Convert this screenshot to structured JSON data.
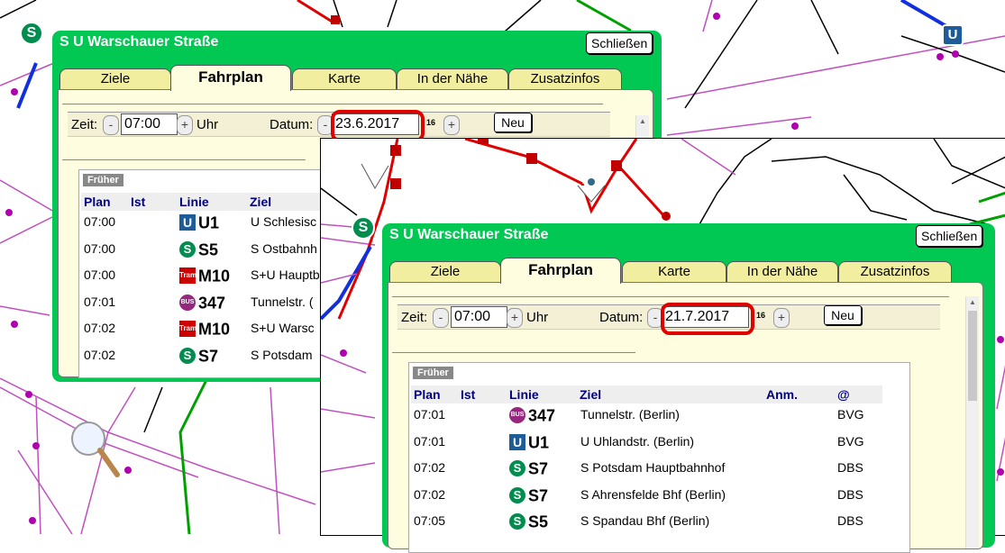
{
  "colors": {
    "panel_green": "#00c853",
    "tab_yellow": "#f2eea0",
    "highlight_red": "#e00000",
    "header_blue": "#000080"
  },
  "icons": [
    "magnifier-icon",
    "s-bahn-icon",
    "u-bahn-icon",
    "tram-icon",
    "bus-icon",
    "calendar-icon"
  ],
  "map_icons": {
    "s": "S",
    "u": "U"
  },
  "panel_a": {
    "title": "S U Warschauer Straße",
    "close_label": "Schließen",
    "tabs": [
      "Ziele",
      "Fahrplan",
      "Karte",
      "In der Nähe",
      "Zusatzinfos"
    ],
    "active_tab": "Fahrplan",
    "controls": {
      "zeit_label": "Zeit:",
      "minus": "-",
      "plus": "+",
      "time": "07:00",
      "uhr_label": "Uhr",
      "datum_label": "Datum:",
      "date": "23.6.2017",
      "calendar": "16",
      "neu_label": "Neu"
    },
    "earlier_label": "Früher",
    "headers": [
      "Plan",
      "Ist",
      "Linie",
      "Ziel"
    ],
    "rows": [
      {
        "plan": "07:00",
        "icon": "U",
        "line": "U1",
        "ziel": "U Schlesisc"
      },
      {
        "plan": "07:00",
        "icon": "S",
        "line": "S5",
        "ziel": "S Ostbahnh"
      },
      {
        "plan": "07:00",
        "icon": "Tram",
        "line": "M10",
        "ziel": "S+U Hauptb"
      },
      {
        "plan": "07:01",
        "icon": "BUS",
        "line": "347",
        "ziel": "Tunnelstr. ("
      },
      {
        "plan": "07:02",
        "icon": "Tram",
        "line": "M10",
        "ziel": "S+U Warsc"
      },
      {
        "plan": "07:02",
        "icon": "S",
        "line": "S7",
        "ziel": "S Potsdam"
      }
    ]
  },
  "panel_b": {
    "title": "S U Warschauer Straße",
    "close_label": "Schließen",
    "tabs": [
      "Ziele",
      "Fahrplan",
      "Karte",
      "In der Nähe",
      "Zusatzinfos"
    ],
    "active_tab": "Fahrplan",
    "controls": {
      "zeit_label": "Zeit:",
      "minus": "-",
      "plus": "+",
      "time": "07:00",
      "uhr_label": "Uhr",
      "datum_label": "Datum:",
      "date": "21.7.2017",
      "calendar": "16",
      "neu_label": "Neu"
    },
    "earlier_label": "Früher",
    "headers": [
      "Plan",
      "Ist",
      "Linie",
      "Ziel",
      "Anm.",
      "@"
    ],
    "rows": [
      {
        "plan": "07:01",
        "icon": "BUS",
        "line": "347",
        "ziel": "Tunnelstr. (Berlin)",
        "op": "BVG"
      },
      {
        "plan": "07:01",
        "icon": "U",
        "line": "U1",
        "ziel": "U Uhlandstr. (Berlin)",
        "op": "BVG"
      },
      {
        "plan": "07:02",
        "icon": "S",
        "line": "S7",
        "ziel": "S Potsdam Hauptbahnhof",
        "op": "DBS"
      },
      {
        "plan": "07:02",
        "icon": "S",
        "line": "S7",
        "ziel": "S Ahrensfelde Bhf (Berlin)",
        "op": "DBS"
      },
      {
        "plan": "07:05",
        "icon": "S",
        "line": "S5",
        "ziel": "S Spandau Bhf (Berlin)",
        "op": "DBS"
      }
    ]
  }
}
